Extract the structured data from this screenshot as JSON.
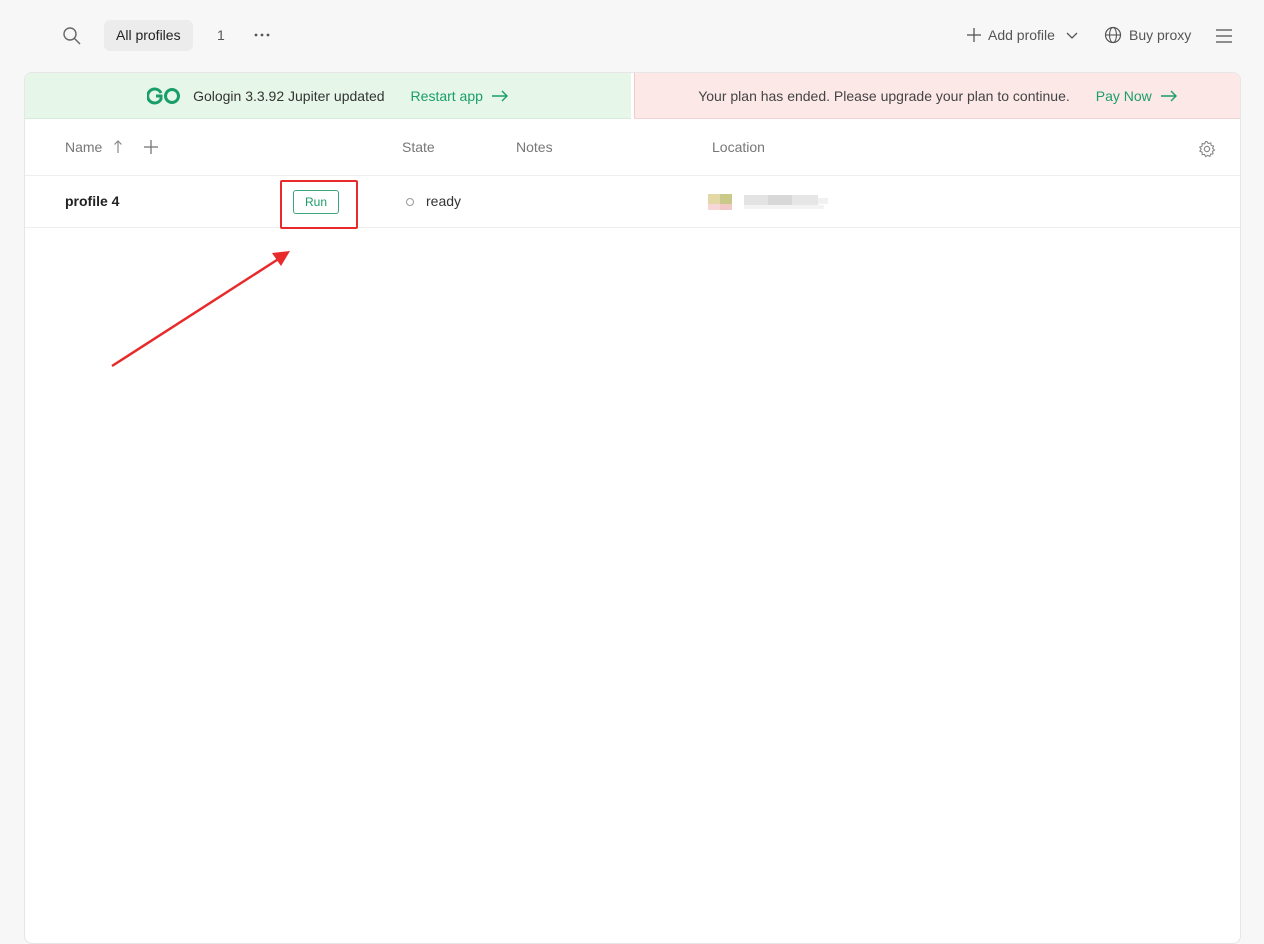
{
  "toolbar": {
    "search_icon": "search-icon",
    "tab_all_label": "All profiles",
    "tab_count": "1",
    "more_icon": "more-dots-icon",
    "add_profile_label": "Add profile",
    "buy_proxy_label": "Buy proxy",
    "menu_icon": "hamburger-menu-icon"
  },
  "banners": {
    "update": {
      "logo": "GO",
      "message": "Gologin 3.3.92 Jupiter updated",
      "action": "Restart app"
    },
    "plan": {
      "message": "Your plan has ended. Please upgrade your plan to continue.",
      "action": "Pay Now"
    }
  },
  "table": {
    "columns": [
      "Name",
      "State",
      "Notes",
      "Location"
    ],
    "rows": [
      {
        "name": "profile 4",
        "run_label": "Run",
        "state": "ready",
        "notes": ""
      }
    ]
  },
  "colors": {
    "accent": "#1a9e68",
    "update_banner_bg": "#e6f7e9",
    "plan_banner_bg": "#fde8e8",
    "annotation_red": "#e82a2a"
  }
}
